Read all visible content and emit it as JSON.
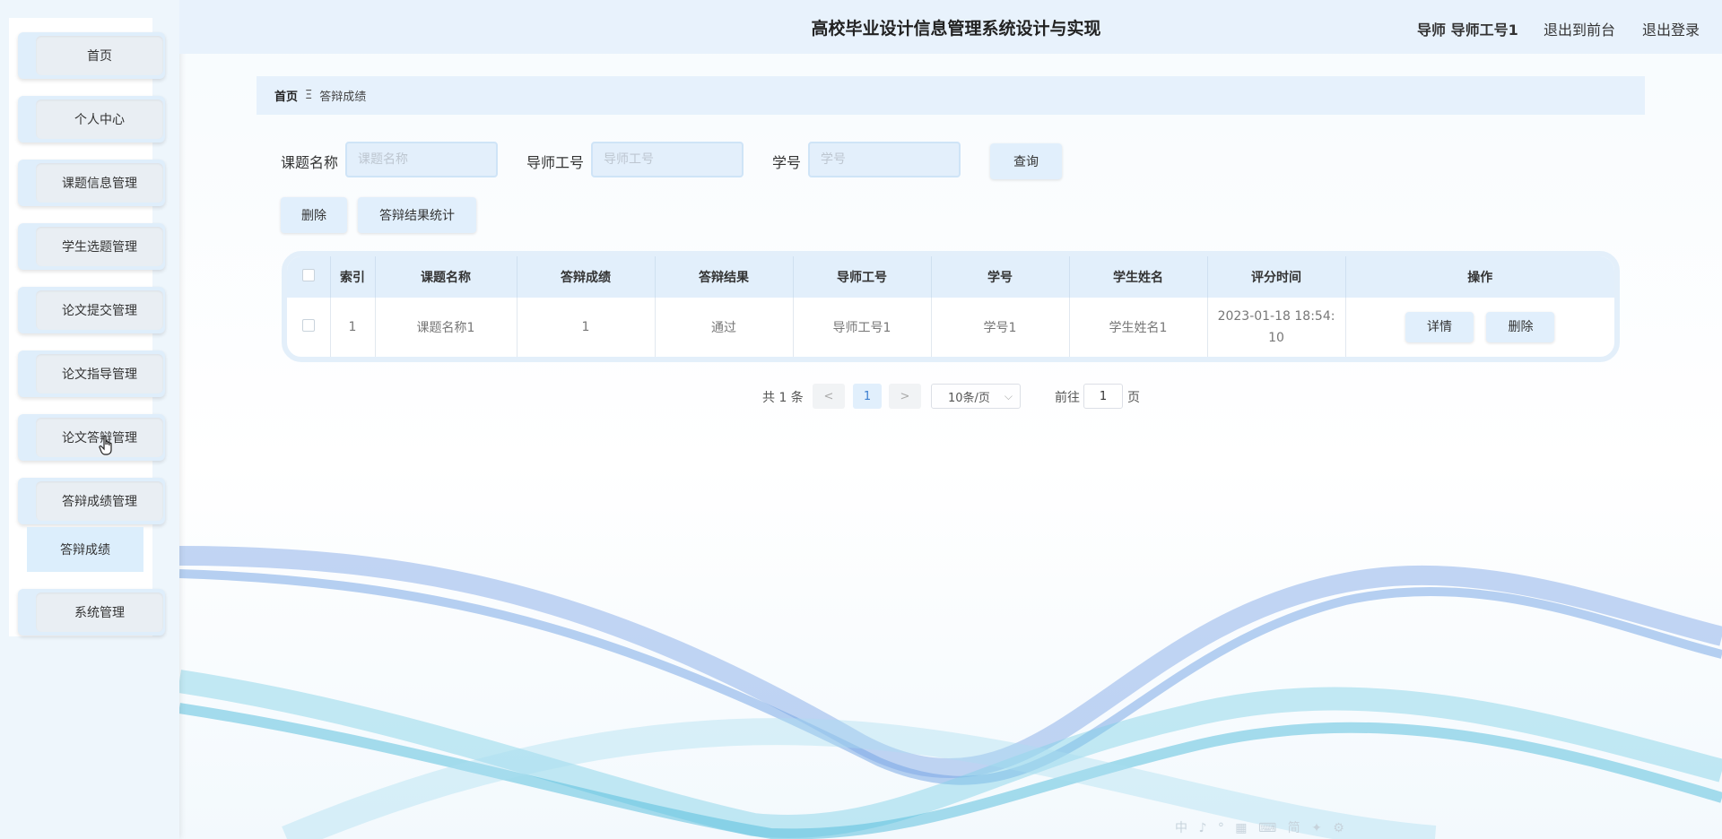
{
  "header": {
    "title": "高校毕业设计信息管理系统设计与实现",
    "user": "导师 导师工号1",
    "front_link": "退出到前台",
    "logout_link": "退出登录"
  },
  "sidebar": {
    "items": [
      {
        "label": "首页"
      },
      {
        "label": "个人中心"
      },
      {
        "label": "课题信息管理"
      },
      {
        "label": "学生选题管理"
      },
      {
        "label": "论文提交管理"
      },
      {
        "label": "论文指导管理"
      },
      {
        "label": "论文答辩管理"
      },
      {
        "label": "答辩成绩管理"
      },
      {
        "label": "系统管理"
      }
    ],
    "submenu": {
      "label": "答辩成绩"
    }
  },
  "breadcrumb": {
    "home": "首页",
    "separator": "Ξ",
    "current": "答辩成绩"
  },
  "search": {
    "topic_label": "课题名称",
    "topic_placeholder": "课题名称",
    "teacher_label": "导师工号",
    "teacher_placeholder": "导师工号",
    "student_label": "学号",
    "student_placeholder": "学号",
    "query_button": "查询"
  },
  "actions": {
    "delete_button": "删除",
    "stats_button": "答辩结果统计"
  },
  "table": {
    "columns": [
      "索引",
      "课题名称",
      "答辩成绩",
      "答辩结果",
      "导师工号",
      "学号",
      "学生姓名",
      "评分时间",
      "操作"
    ],
    "rows": [
      {
        "index": "1",
        "topic": "课题名称1",
        "score": "1",
        "result": "通过",
        "teacher_id": "导师工号1",
        "student_id": "学号1",
        "student_name": "学生姓名1",
        "time": "2023-01-18 18:54:10",
        "detail": "详情",
        "delete": "删除"
      }
    ]
  },
  "pagination": {
    "total": "共 1 条",
    "prev": "<",
    "current": "1",
    "next": ">",
    "page_size": "10条/页",
    "goto_label": "前往",
    "goto_value": "1",
    "page_suffix": "页"
  },
  "ime_toolbar": "中 ♪ ° ▦ ⌨ 简 ✦ ⚙",
  "colors": {
    "accent": "#e1effc",
    "header_bg": "#e8f2fc",
    "sidebar_bg": "#eef6fc"
  }
}
